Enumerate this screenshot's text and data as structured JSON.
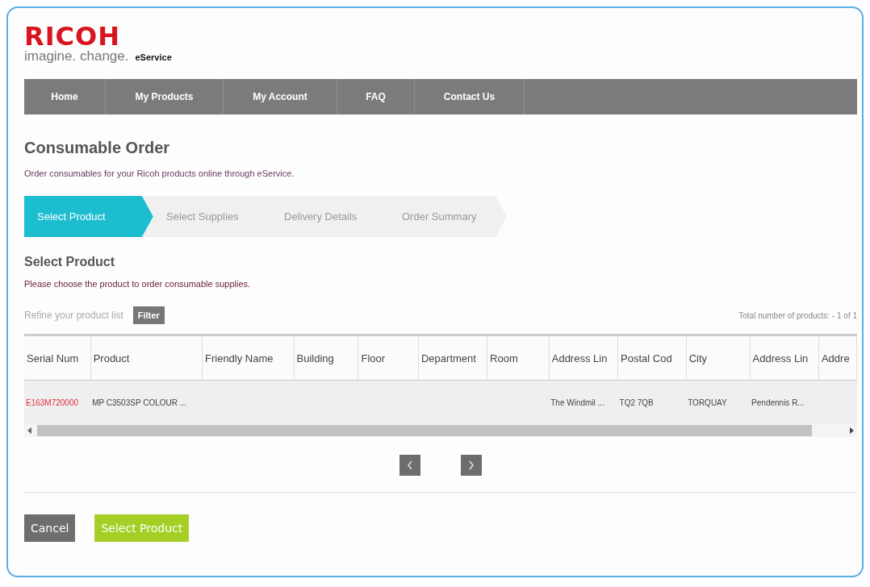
{
  "logo": {
    "brand": "RICOH",
    "tagline": "imagine. change.",
    "product": "eService"
  },
  "nav": [
    {
      "label": "Home"
    },
    {
      "label": "My Products"
    },
    {
      "label": "My Account"
    },
    {
      "label": "FAQ"
    },
    {
      "label": "Contact Us"
    }
  ],
  "page": {
    "title": "Consumable Order",
    "intro": "Order consumables for your Ricoh products online through eService."
  },
  "steps": [
    {
      "label": "Select Product",
      "selected": true
    },
    {
      "label": "Select Supplies",
      "selected": false
    },
    {
      "label": "Delivery Details",
      "selected": false
    },
    {
      "label": "Order Summary",
      "selected": false
    }
  ],
  "section": {
    "title": "Select Product",
    "instruction": "Please choose the product to order consumable supplies."
  },
  "refine": {
    "label": "Refine your product list",
    "button": "Filter",
    "total": "Total number of products: - 1 of 1"
  },
  "table": {
    "columns": [
      "Serial Num",
      "Product",
      "Friendly Name",
      "Building",
      "Floor",
      "Department",
      "Room",
      "Address Lin",
      "Postal Cod",
      "City",
      "Address Lin",
      "Addre"
    ],
    "rows": [
      {
        "cells": [
          "E163M720000",
          "MP C3503SP COLOUR ...",
          "",
          "",
          "",
          "",
          "",
          "The Windmil ...",
          "TQ2 7QB",
          "TORQUAY",
          "Pendennis R...",
          ""
        ]
      }
    ]
  },
  "buttons": {
    "cancel": "Cancel",
    "submit": "Select Product"
  }
}
